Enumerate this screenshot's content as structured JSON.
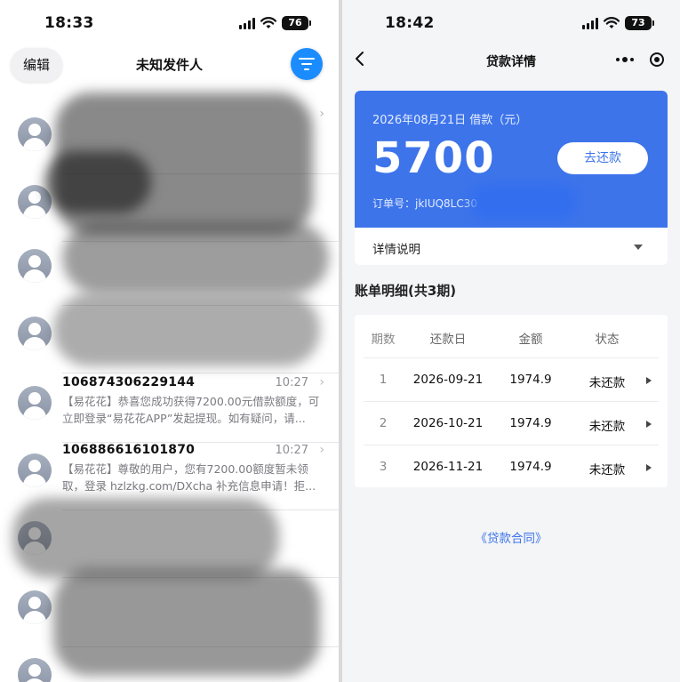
{
  "left_screen": {
    "status_bar": {
      "time": "18:33",
      "battery": "76"
    },
    "nav": {
      "edit_label": "编辑",
      "title": "未知发件人"
    },
    "messages": [
      {
        "sender": "",
        "time": "",
        "preview": ""
      },
      {
        "sender": "",
        "time": "",
        "preview": ""
      },
      {
        "sender": "",
        "time": "",
        "preview": ""
      },
      {
        "sender": "",
        "time": "",
        "preview": ""
      },
      {
        "sender": "106874306229144",
        "time": "10:27",
        "preview": "【易花花】恭喜您成功获得7200.00元借款额度，可立即登录“易花花APP”发起提现。如有疑问，请..."
      },
      {
        "sender": "106886616101870",
        "time": "10:27",
        "preview": "【易花花】尊敬的用户，您有7200.00额度暂未领取，登录 hzlzkg.com/DXcha 补充信息申请！拒..."
      },
      {
        "sender": "",
        "time": "",
        "preview": ""
      },
      {
        "sender": "",
        "time": "",
        "preview": ""
      },
      {
        "sender": "",
        "time": "",
        "preview": ""
      }
    ]
  },
  "right_screen": {
    "status_bar": {
      "time": "18:42",
      "battery": "73"
    },
    "nav": {
      "title": "贷款详情"
    },
    "loan_card": {
      "date_label": "2026年08月21日 借款（元）",
      "amount": "5700",
      "repay_button": "去还款",
      "order_no": "订单号：jkIUQ8LC30",
      "details_label": "详情说明"
    },
    "bill_heading": "账单明细(共3期)",
    "bill_table": {
      "headers": [
        "期数",
        "还款日",
        "金额",
        "状态"
      ],
      "rows": [
        {
          "period": "1",
          "due_date": "2026-09-21",
          "amount": "1974.9",
          "status": "未还款"
        },
        {
          "period": "2",
          "due_date": "2026-10-21",
          "amount": "1974.9",
          "status": "未还款"
        },
        {
          "period": "3",
          "due_date": "2026-11-21",
          "amount": "1974.9",
          "status": "未还款"
        }
      ]
    },
    "contract_link": "《贷款合同》"
  },
  "colors": {
    "card_blue": "#3d74ea",
    "filter_button_blue": "#1a8cff",
    "redaction": "#2a2a2a"
  }
}
